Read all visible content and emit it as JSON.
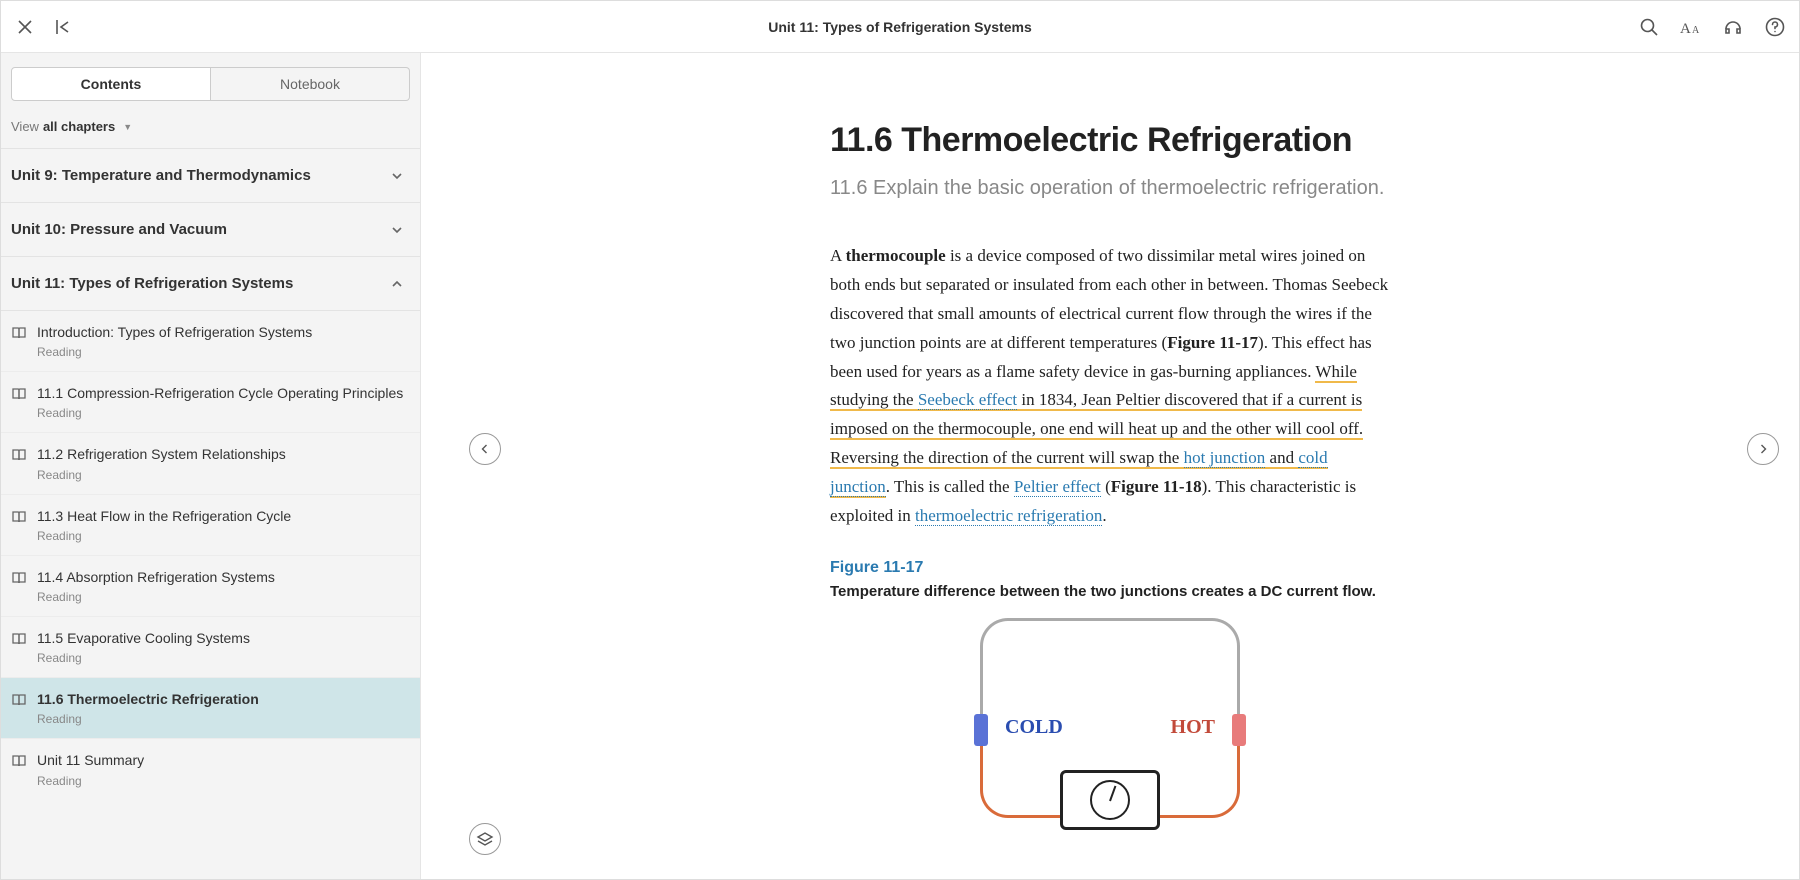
{
  "header": {
    "title": "Unit 11: Types of Refrigeration Systems"
  },
  "sidebar": {
    "tabs": {
      "contents": "Contents",
      "notebook": "Notebook"
    },
    "view_label": "View",
    "view_value": "all chapters",
    "chapters": [
      {
        "title": "Unit 9: Temperature and Thermodynamics",
        "expanded": false
      },
      {
        "title": "Unit 10: Pressure and Vacuum",
        "expanded": false
      },
      {
        "title": "Unit 11: Types of Refrigeration Systems",
        "expanded": true
      }
    ],
    "toc": [
      {
        "title": "Introduction: Types of Refrigeration Systems",
        "type": "Reading"
      },
      {
        "title": "11.1 Compression-Refrigeration Cycle Operating Principles",
        "type": "Reading"
      },
      {
        "title": "11.2 Refrigeration System Relationships",
        "type": "Reading"
      },
      {
        "title": "11.3 Heat Flow in the Refrigeration Cycle",
        "type": "Reading"
      },
      {
        "title": "11.4 Absorption Refrigeration Systems",
        "type": "Reading"
      },
      {
        "title": "11.5 Evaporative Cooling Systems",
        "type": "Reading"
      },
      {
        "title": "11.6 Thermoelectric Refrigeration",
        "type": "Reading",
        "active": true
      },
      {
        "title": "Unit 11 Summary",
        "type": "Reading"
      }
    ]
  },
  "content": {
    "h1": "11.6 Thermoelectric Refrigeration",
    "subtitle": "11.6 Explain the basic operation of thermoelectric refrigeration.",
    "p1_a": "A ",
    "p1_bold": "thermocouple",
    "p1_b": " is a device composed of two dissimilar metal wires joined on both ends but separated or insulated from each other in between. Thomas Seebeck discovered that small amounts of electrical current flow through the wires if the two junction points are at different temperatures (",
    "p1_fig": "Figure 11-17",
    "p1_c": "). This effect has been used for years as a flame safety device in gas-burning appliances. ",
    "p1_hl1": "While studying the ",
    "p1_link1": "Seebeck effect",
    "p1_hl2": " in 1834, Jean Peltier discovered that if a current is imposed on the thermocouple, one end will heat up and the other will cool off. Reversing the direction of the current will swap the ",
    "p1_link2": "hot junction",
    "p1_hl3": " and ",
    "p1_link3": "cold junction",
    "p1_d": ". This is called the ",
    "p1_link4": "Peltier effect",
    "p1_e": " (",
    "p1_fig2": "Figure 11-18",
    "p1_f": "). This characteristic is exploited in ",
    "p1_link5": "thermoelectric refrigeration",
    "p1_g": ".",
    "figure": {
      "label": "Figure 11-17",
      "caption": "Temperature difference between the two junctions creates a DC current flow.",
      "cold": "COLD",
      "hot": "HOT"
    }
  }
}
